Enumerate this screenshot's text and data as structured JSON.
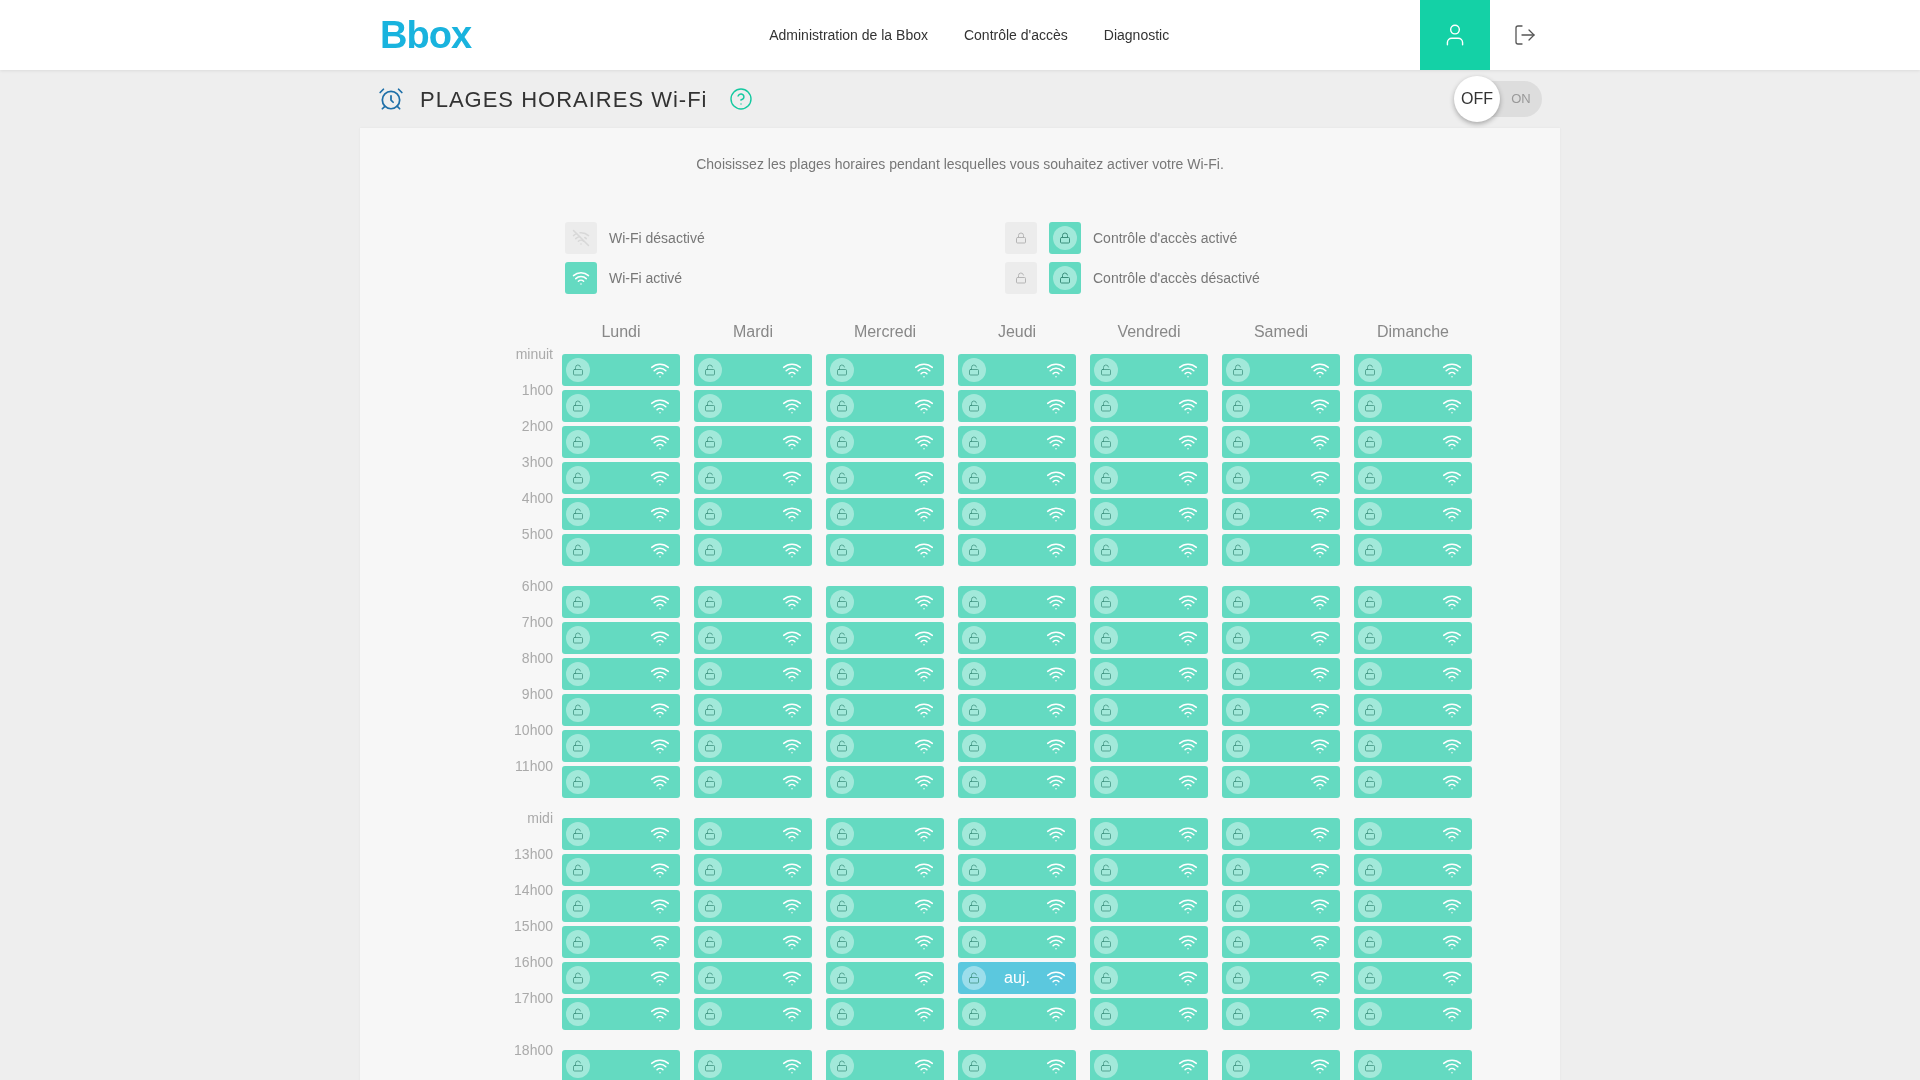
{
  "header": {
    "logo": "Bbox",
    "nav": [
      {
        "label": "Administration de la Bbox"
      },
      {
        "label": "Contrôle d'accès"
      },
      {
        "label": "Diagnostic"
      }
    ],
    "account_selected": true
  },
  "title": "PLAGES HORAIRES Wi-Fi",
  "wifi_toggle": {
    "on": false,
    "off_label": "OFF",
    "on_label": "ON"
  },
  "description": "Choisissez les plages horaires pendant lesquelles vous souhaitez activer votre Wi-Fi.",
  "legend": [
    {
      "kind": "wifi_off",
      "label": "Wi-Fi désactivé"
    },
    {
      "kind": "access_on",
      "label": "Contrôle d'accès activé"
    },
    {
      "kind": "wifi_on",
      "label": "Wi-Fi activé"
    },
    {
      "kind": "access_off",
      "label": "Contrôle d'accès désactivé"
    }
  ],
  "days": [
    "Lundi",
    "Mardi",
    "Mercredi",
    "Jeudi",
    "Vendredi",
    "Samedi",
    "Dimanche"
  ],
  "groups": [
    {
      "rows": [
        {
          "time": "minuit",
          "cells": [
            {
              "wifi": true,
              "locked": false
            },
            {
              "wifi": true,
              "locked": false
            },
            {
              "wifi": true,
              "locked": false
            },
            {
              "wifi": true,
              "locked": false
            },
            {
              "wifi": true,
              "locked": false
            },
            {
              "wifi": true,
              "locked": false
            },
            {
              "wifi": true,
              "locked": false
            }
          ]
        },
        {
          "time": "1h00",
          "cells": [
            {
              "wifi": true,
              "locked": false
            },
            {
              "wifi": true,
              "locked": false
            },
            {
              "wifi": true,
              "locked": false
            },
            {
              "wifi": true,
              "locked": false
            },
            {
              "wifi": true,
              "locked": false
            },
            {
              "wifi": true,
              "locked": false
            },
            {
              "wifi": true,
              "locked": false
            }
          ]
        },
        {
          "time": "2h00",
          "cells": [
            {
              "wifi": true,
              "locked": false
            },
            {
              "wifi": true,
              "locked": false
            },
            {
              "wifi": true,
              "locked": false
            },
            {
              "wifi": true,
              "locked": false
            },
            {
              "wifi": true,
              "locked": false
            },
            {
              "wifi": true,
              "locked": false
            },
            {
              "wifi": true,
              "locked": false
            }
          ]
        },
        {
          "time": "3h00",
          "cells": [
            {
              "wifi": true,
              "locked": false
            },
            {
              "wifi": true,
              "locked": false
            },
            {
              "wifi": true,
              "locked": false
            },
            {
              "wifi": true,
              "locked": false
            },
            {
              "wifi": true,
              "locked": false
            },
            {
              "wifi": true,
              "locked": false
            },
            {
              "wifi": true,
              "locked": false
            }
          ]
        },
        {
          "time": "4h00",
          "cells": [
            {
              "wifi": true,
              "locked": false
            },
            {
              "wifi": true,
              "locked": false
            },
            {
              "wifi": true,
              "locked": false
            },
            {
              "wifi": true,
              "locked": false
            },
            {
              "wifi": true,
              "locked": false
            },
            {
              "wifi": true,
              "locked": false
            },
            {
              "wifi": true,
              "locked": false
            }
          ]
        },
        {
          "time": "5h00",
          "cells": [
            {
              "wifi": true,
              "locked": false
            },
            {
              "wifi": true,
              "locked": false
            },
            {
              "wifi": true,
              "locked": false
            },
            {
              "wifi": true,
              "locked": false
            },
            {
              "wifi": true,
              "locked": false
            },
            {
              "wifi": true,
              "locked": false
            },
            {
              "wifi": true,
              "locked": false
            }
          ]
        }
      ]
    },
    {
      "rows": [
        {
          "time": "6h00",
          "cells": [
            {
              "wifi": true,
              "locked": false
            },
            {
              "wifi": true,
              "locked": false
            },
            {
              "wifi": true,
              "locked": false
            },
            {
              "wifi": true,
              "locked": false
            },
            {
              "wifi": true,
              "locked": false
            },
            {
              "wifi": true,
              "locked": false
            },
            {
              "wifi": true,
              "locked": false
            }
          ]
        },
        {
          "time": "7h00",
          "cells": [
            {
              "wifi": true,
              "locked": false
            },
            {
              "wifi": true,
              "locked": false
            },
            {
              "wifi": true,
              "locked": false
            },
            {
              "wifi": true,
              "locked": false
            },
            {
              "wifi": true,
              "locked": false
            },
            {
              "wifi": true,
              "locked": false
            },
            {
              "wifi": true,
              "locked": false
            }
          ]
        },
        {
          "time": "8h00",
          "cells": [
            {
              "wifi": true,
              "locked": false
            },
            {
              "wifi": true,
              "locked": false
            },
            {
              "wifi": true,
              "locked": false
            },
            {
              "wifi": true,
              "locked": false
            },
            {
              "wifi": true,
              "locked": false
            },
            {
              "wifi": true,
              "locked": false
            },
            {
              "wifi": true,
              "locked": false
            }
          ]
        },
        {
          "time": "9h00",
          "cells": [
            {
              "wifi": true,
              "locked": false
            },
            {
              "wifi": true,
              "locked": false
            },
            {
              "wifi": true,
              "locked": false
            },
            {
              "wifi": true,
              "locked": false
            },
            {
              "wifi": true,
              "locked": false
            },
            {
              "wifi": true,
              "locked": false
            },
            {
              "wifi": true,
              "locked": false
            }
          ]
        },
        {
          "time": "10h00",
          "cells": [
            {
              "wifi": true,
              "locked": false
            },
            {
              "wifi": true,
              "locked": false
            },
            {
              "wifi": true,
              "locked": false
            },
            {
              "wifi": true,
              "locked": false
            },
            {
              "wifi": true,
              "locked": false
            },
            {
              "wifi": true,
              "locked": false
            },
            {
              "wifi": true,
              "locked": false
            }
          ]
        },
        {
          "time": "11h00",
          "cells": [
            {
              "wifi": true,
              "locked": false
            },
            {
              "wifi": true,
              "locked": false
            },
            {
              "wifi": true,
              "locked": false
            },
            {
              "wifi": true,
              "locked": false
            },
            {
              "wifi": true,
              "locked": false
            },
            {
              "wifi": true,
              "locked": false
            },
            {
              "wifi": true,
              "locked": false
            }
          ]
        }
      ]
    },
    {
      "rows": [
        {
          "time": "midi",
          "cells": [
            {
              "wifi": true,
              "locked": false
            },
            {
              "wifi": true,
              "locked": false
            },
            {
              "wifi": true,
              "locked": false
            },
            {
              "wifi": true,
              "locked": false
            },
            {
              "wifi": true,
              "locked": false
            },
            {
              "wifi": true,
              "locked": false
            },
            {
              "wifi": true,
              "locked": false
            }
          ]
        },
        {
          "time": "13h00",
          "cells": [
            {
              "wifi": true,
              "locked": false
            },
            {
              "wifi": true,
              "locked": false
            },
            {
              "wifi": true,
              "locked": false
            },
            {
              "wifi": true,
              "locked": false
            },
            {
              "wifi": true,
              "locked": false
            },
            {
              "wifi": true,
              "locked": false
            },
            {
              "wifi": true,
              "locked": false
            }
          ]
        },
        {
          "time": "14h00",
          "cells": [
            {
              "wifi": true,
              "locked": false
            },
            {
              "wifi": true,
              "locked": false
            },
            {
              "wifi": true,
              "locked": false
            },
            {
              "wifi": true,
              "locked": false
            },
            {
              "wifi": true,
              "locked": false
            },
            {
              "wifi": true,
              "locked": false
            },
            {
              "wifi": true,
              "locked": false
            }
          ]
        },
        {
          "time": "15h00",
          "cells": [
            {
              "wifi": true,
              "locked": false
            },
            {
              "wifi": true,
              "locked": false
            },
            {
              "wifi": true,
              "locked": false
            },
            {
              "wifi": true,
              "locked": false
            },
            {
              "wifi": true,
              "locked": false
            },
            {
              "wifi": true,
              "locked": false
            },
            {
              "wifi": true,
              "locked": false
            }
          ]
        },
        {
          "time": "16h00",
          "cells": [
            {
              "wifi": true,
              "locked": false
            },
            {
              "wifi": true,
              "locked": false
            },
            {
              "wifi": true,
              "locked": false
            },
            {
              "wifi": true,
              "locked": false,
              "today": true,
              "label": "auj."
            },
            {
              "wifi": true,
              "locked": false
            },
            {
              "wifi": true,
              "locked": false
            },
            {
              "wifi": true,
              "locked": false
            }
          ]
        },
        {
          "time": "17h00",
          "cells": [
            {
              "wifi": true,
              "locked": false
            },
            {
              "wifi": true,
              "locked": false
            },
            {
              "wifi": true,
              "locked": false
            },
            {
              "wifi": true,
              "locked": false
            },
            {
              "wifi": true,
              "locked": false
            },
            {
              "wifi": true,
              "locked": false
            },
            {
              "wifi": true,
              "locked": false
            }
          ]
        }
      ]
    },
    {
      "rows": [
        {
          "time": "18h00",
          "cells": [
            {
              "wifi": true,
              "locked": false
            },
            {
              "wifi": true,
              "locked": false
            },
            {
              "wifi": true,
              "locked": false
            },
            {
              "wifi": true,
              "locked": false
            },
            {
              "wifi": true,
              "locked": false
            },
            {
              "wifi": true,
              "locked": false
            },
            {
              "wifi": true,
              "locked": false
            }
          ]
        }
      ]
    }
  ]
}
